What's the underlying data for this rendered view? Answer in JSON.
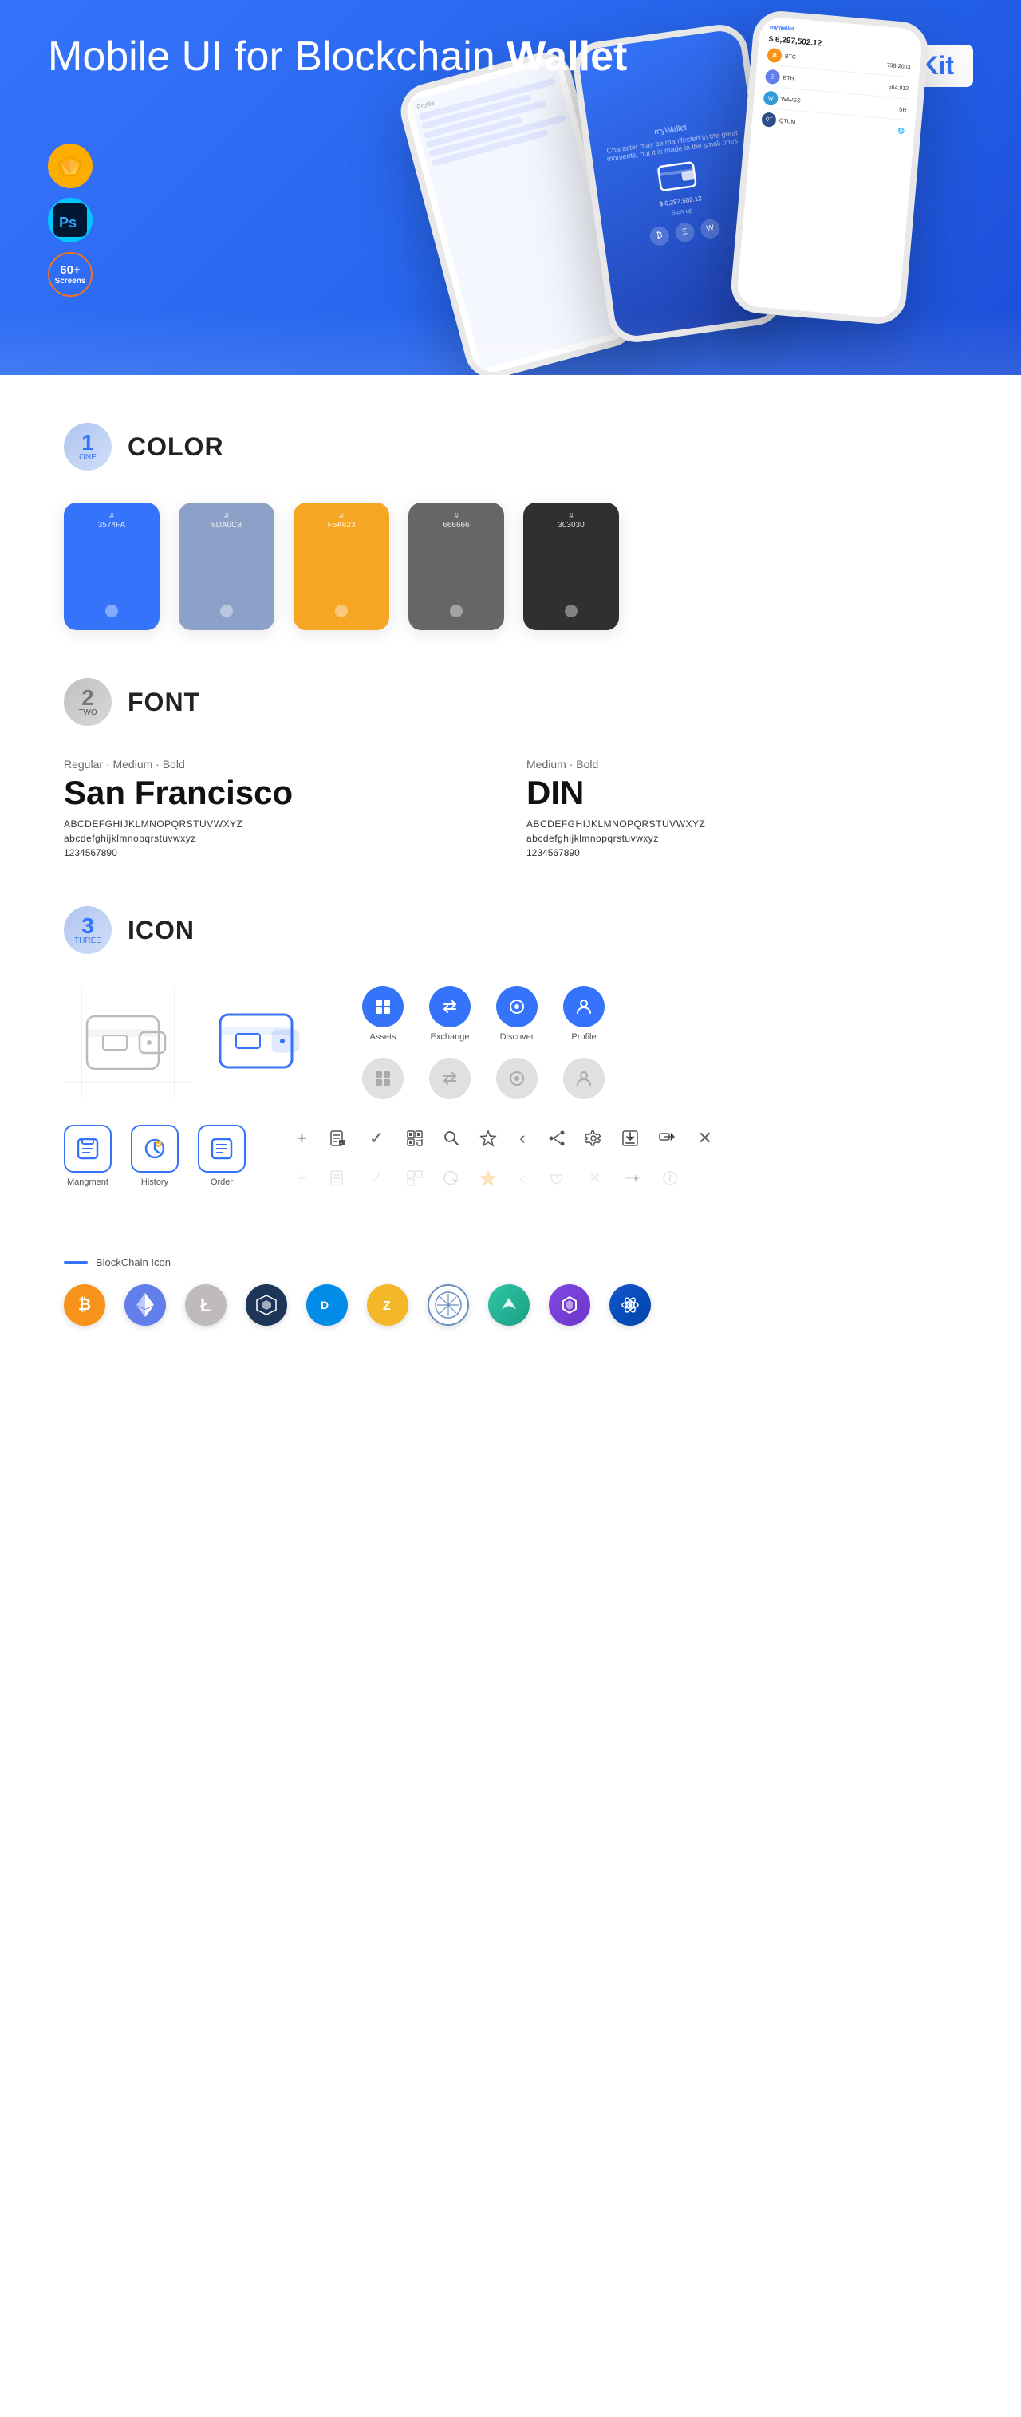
{
  "hero": {
    "title": "Mobile UI for Blockchain ",
    "title_bold": "Wallet",
    "badge": "UI Kit",
    "badge_sketch": "◈",
    "badge_ps": "Ps",
    "badge_screens_num": "60+",
    "badge_screens_label": "Screens"
  },
  "sections": {
    "color": {
      "number": "1",
      "sub": "ONE",
      "title": "COLOR",
      "swatches": [
        {
          "hex": "#3574FA",
          "code": "#\n3574FA"
        },
        {
          "hex": "#8DA0C8",
          "code": "#\n8DA0C8"
        },
        {
          "hex": "#F5A623",
          "code": "#\nF5A623"
        },
        {
          "hex": "#666666",
          "code": "#\n666666"
        },
        {
          "hex": "#303030",
          "code": "#\n303030"
        }
      ]
    },
    "font": {
      "number": "2",
      "sub": "TWO",
      "title": "FONT",
      "fonts": [
        {
          "weight_label": "Regular · Medium · Bold",
          "name": "San Francisco",
          "uppercase": "ABCDEFGHIJKLMNOPQRSTUVWXYZ",
          "lowercase": "abcdefghijklmnopqrstuvwxyz",
          "numbers": "1234567890"
        },
        {
          "weight_label": "Medium · Bold",
          "name": "DIN",
          "uppercase": "ABCDEFGHIJKLMNOPQRSTUVWXYZ",
          "lowercase": "abcdefghijklmnopqrstuvwxyz",
          "numbers": "1234567890"
        }
      ]
    },
    "icon": {
      "number": "3",
      "sub": "THREE",
      "title": "ICON",
      "nav_icons": [
        {
          "label": "Assets",
          "symbol": "◆"
        },
        {
          "label": "Exchange",
          "symbol": "⇄"
        },
        {
          "label": "Discover",
          "symbol": "●"
        },
        {
          "label": "Profile",
          "symbol": "👤"
        }
      ],
      "app_icons": [
        {
          "label": "Mangment",
          "symbol": "▣"
        },
        {
          "label": "History",
          "symbol": "⏱"
        },
        {
          "label": "Order",
          "symbol": "≡"
        }
      ],
      "small_icons": [
        "+",
        "⊞",
        "✓",
        "⊟",
        "🔍",
        "☆",
        "‹",
        "≮",
        "⚙",
        "⊡",
        "⇄",
        "✕"
      ],
      "blockchain_label": "BlockChain Icon",
      "crypto": [
        {
          "symbol": "₿",
          "class": "crypto-btc"
        },
        {
          "symbol": "⬡",
          "class": "crypto-eth"
        },
        {
          "symbol": "Ł",
          "class": "crypto-ltc"
        },
        {
          "symbol": "〜",
          "class": "crypto-waves"
        },
        {
          "symbol": "D",
          "class": "crypto-dash"
        },
        {
          "symbol": "Z",
          "class": "crypto-zcash"
        },
        {
          "symbol": "◈",
          "class": "crypto-iota"
        },
        {
          "symbol": "↑",
          "class": "crypto-ardor"
        },
        {
          "symbol": "▲",
          "class": "crypto-matic"
        },
        {
          "symbol": "∞",
          "class": "crypto-other"
        }
      ]
    }
  }
}
